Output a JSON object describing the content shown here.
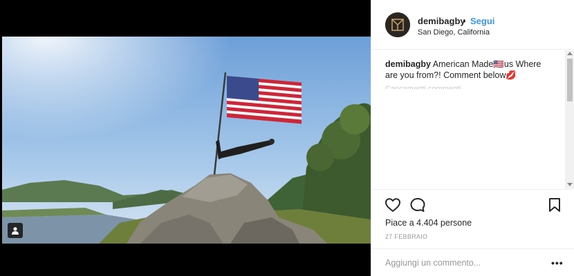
{
  "post": {
    "username": "demibagby",
    "follow_separator": "•",
    "follow_label": "Segui",
    "location": "San Diego, California",
    "caption_user": "demibagby",
    "caption_text": "American Made🇺🇸us Where are you from?! Comment below💋",
    "load_more_text": "Caricamenti commenti...",
    "likes_text": "Piace a 4.404 persone",
    "date_text": "27 FEBBRAIO",
    "comment_placeholder": "Aggiungi un commento...",
    "more_options": "•••"
  },
  "icons": {
    "like": "heart-icon",
    "comment": "comment-bubble-icon",
    "save": "bookmark-icon",
    "user_tag": "user-tag-icon"
  },
  "colors": {
    "link_blue": "#3897f0",
    "text": "#262626",
    "muted": "#999999",
    "border": "#efefef"
  }
}
